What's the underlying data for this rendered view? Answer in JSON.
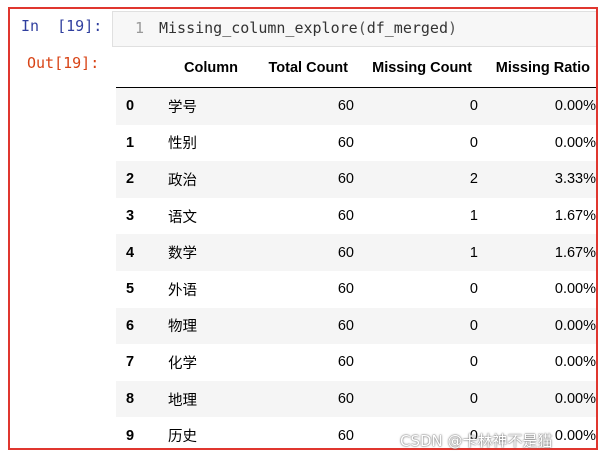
{
  "cell": {
    "in_prompt": "In  [19]:",
    "line_number": "1",
    "code_func": "Missing_column_explore",
    "code_open": "(",
    "code_arg": "df_merged",
    "code_close": ")",
    "out_prompt": "Out[19]:"
  },
  "table": {
    "headers": [
      "",
      "Column",
      "Total Count",
      "Missing Count",
      "Missing Ratio"
    ],
    "rows": [
      {
        "index": "0",
        "column": "学号",
        "total": "60",
        "missing": "0",
        "ratio": "0.00%"
      },
      {
        "index": "1",
        "column": "性别",
        "total": "60",
        "missing": "0",
        "ratio": "0.00%"
      },
      {
        "index": "2",
        "column": "政治",
        "total": "60",
        "missing": "2",
        "ratio": "3.33%"
      },
      {
        "index": "3",
        "column": "语文",
        "total": "60",
        "missing": "1",
        "ratio": "1.67%"
      },
      {
        "index": "4",
        "column": "数学",
        "total": "60",
        "missing": "1",
        "ratio": "1.67%"
      },
      {
        "index": "5",
        "column": "外语",
        "total": "60",
        "missing": "0",
        "ratio": "0.00%"
      },
      {
        "index": "6",
        "column": "物理",
        "total": "60",
        "missing": "0",
        "ratio": "0.00%"
      },
      {
        "index": "7",
        "column": "化学",
        "total": "60",
        "missing": "0",
        "ratio": "0.00%"
      },
      {
        "index": "8",
        "column": "地理",
        "total": "60",
        "missing": "0",
        "ratio": "0.00%"
      },
      {
        "index": "9",
        "column": "历史",
        "total": "60",
        "missing": "0",
        "ratio": "0.00%"
      }
    ]
  },
  "watermark": "CSDN @卡林神不是猫",
  "colors": {
    "frame_border": "#e0362f",
    "in_prompt": "#303f9f",
    "out_prompt": "#d84315"
  }
}
